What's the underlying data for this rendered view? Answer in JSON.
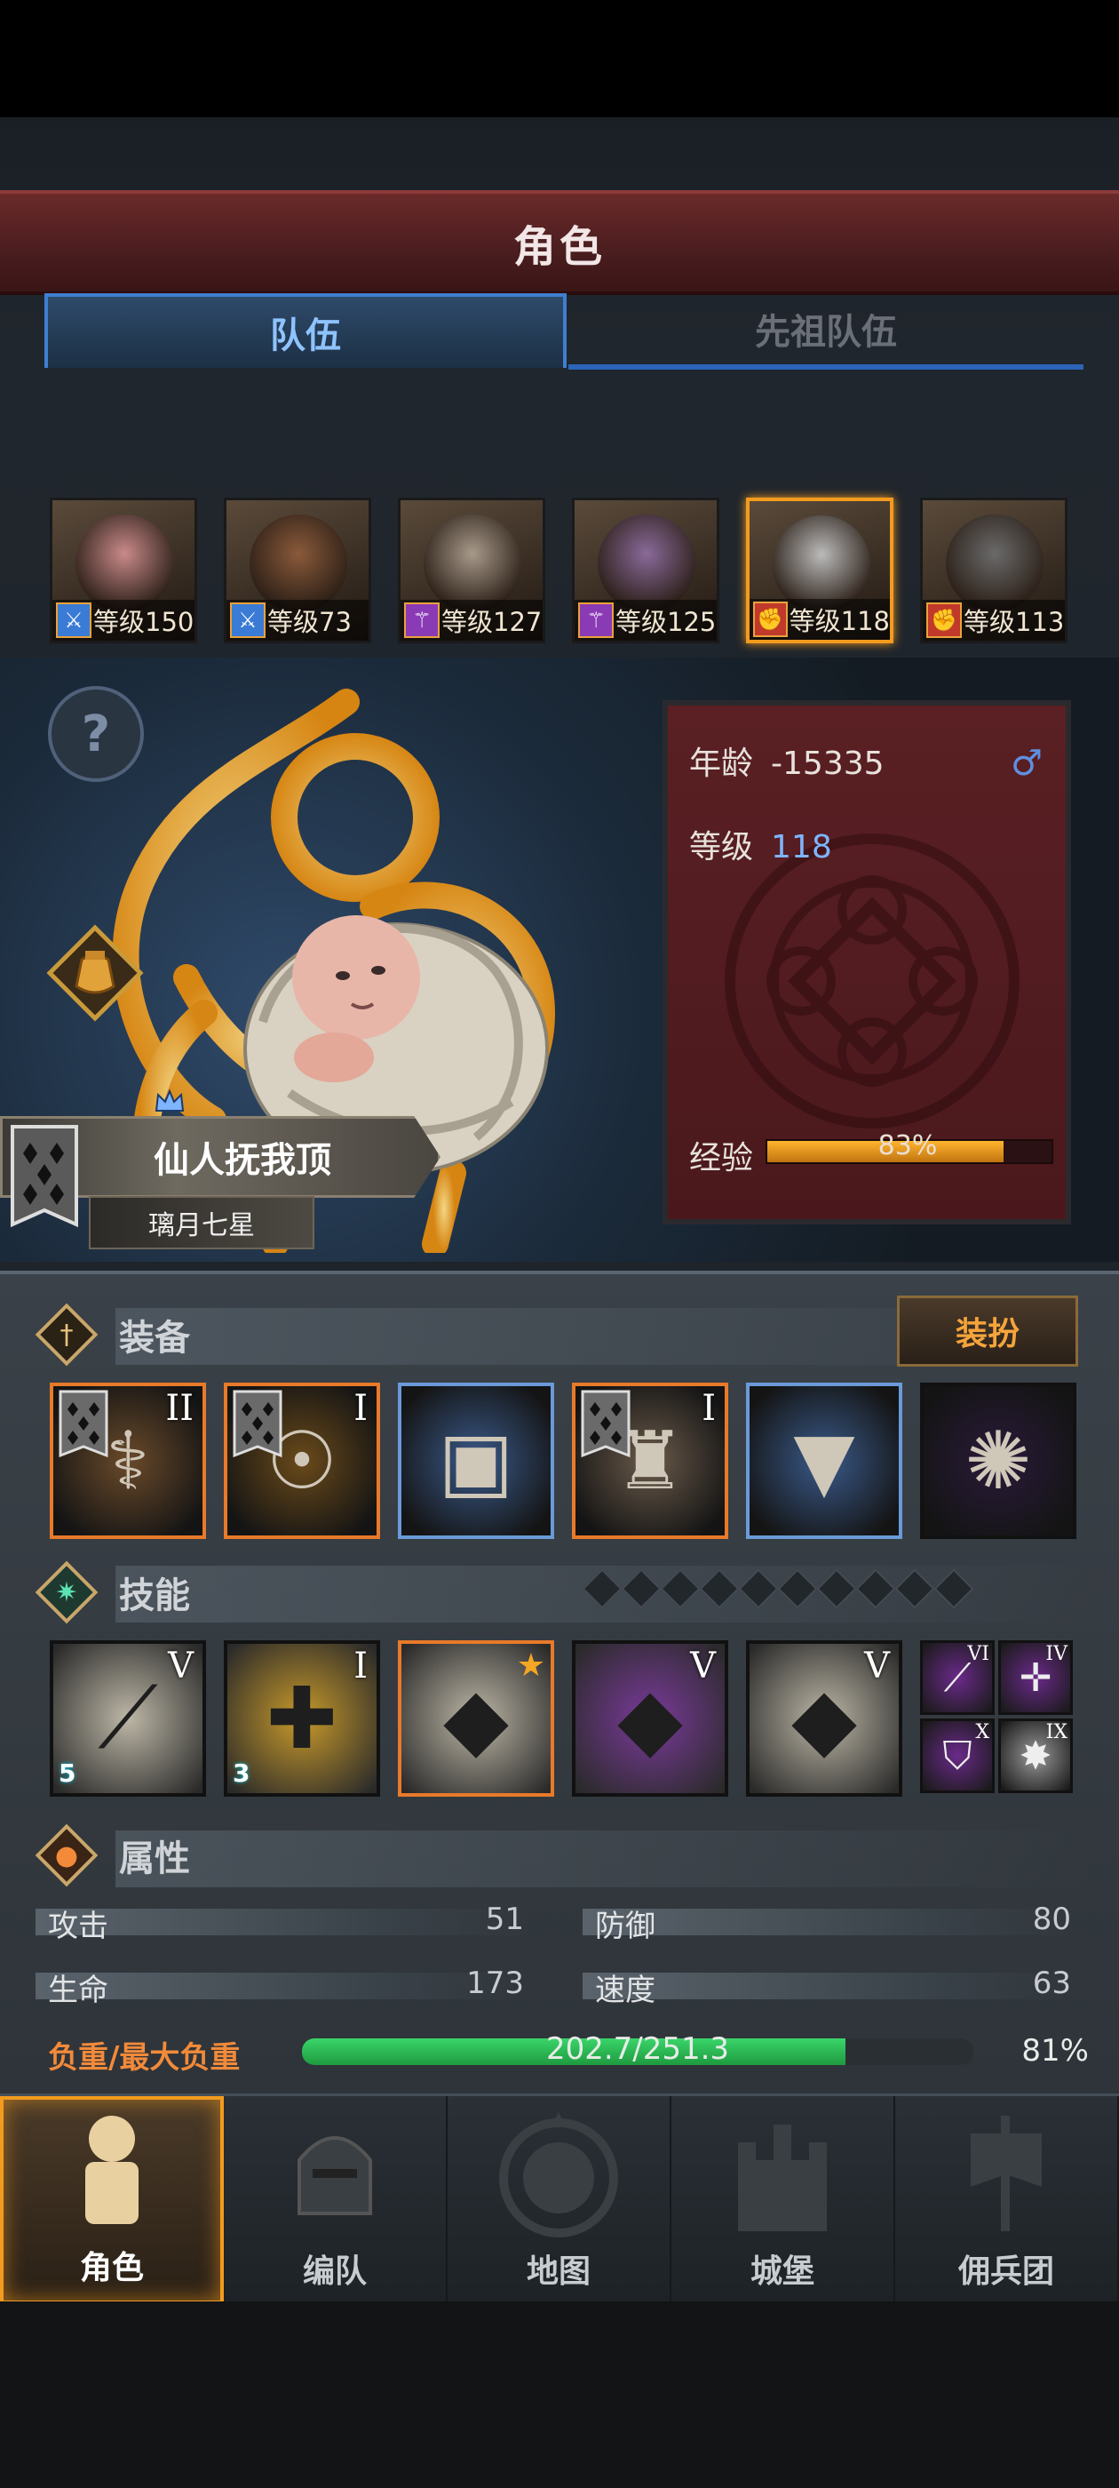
{
  "header": {
    "title": "角色"
  },
  "tabs": [
    {
      "label": "队伍",
      "active": true
    },
    {
      "label": "先祖队伍",
      "active": false
    }
  ],
  "party": [
    {
      "level_text": "等级150",
      "class_icon": "sword-icon",
      "badge_color": "#3a7bd5",
      "selected": false
    },
    {
      "level_text": "等级73",
      "class_icon": "sword-icon",
      "badge_color": "#3a7bd5",
      "selected": false
    },
    {
      "level_text": "等级127",
      "class_icon": "staff-icon",
      "badge_color": "#8b3ab5",
      "selected": false
    },
    {
      "level_text": "等级125",
      "class_icon": "staff-icon",
      "badge_color": "#8b3ab5",
      "selected": false
    },
    {
      "level_text": "等级118",
      "class_icon": "fist-icon",
      "badge_color": "#c0392b",
      "selected": true
    },
    {
      "level_text": "等级113",
      "class_icon": "fist-icon",
      "badge_color": "#c0392b",
      "selected": false
    }
  ],
  "character": {
    "name": "仙人抚我顶",
    "title": "璃月七星",
    "age_label": "年龄",
    "age_value": "-15335",
    "gender_icon": "male-icon",
    "level_label": "等级",
    "level_value": "118",
    "exp_label": "经验",
    "exp_text": "83%",
    "exp_fraction": 0.83
  },
  "equipment": {
    "title": "装备",
    "dress_label": "装扮",
    "slots": [
      {
        "name": "staff-item",
        "tier": "II",
        "border": "orange"
      },
      {
        "name": "tome-item",
        "tier": "I",
        "border": "orange"
      },
      {
        "name": "helmet-item",
        "tier": "",
        "border": "blue"
      },
      {
        "name": "armor-item",
        "tier": "I",
        "border": "orange"
      },
      {
        "name": "boots-item",
        "tier": "",
        "border": "blue"
      },
      {
        "name": "orb-item",
        "tier": "",
        "border": "black"
      }
    ]
  },
  "skills": {
    "title": "技能",
    "slots": [
      {
        "name": "spear-skill",
        "tier": "V",
        "count": "5",
        "border": "black"
      },
      {
        "name": "shield-heal-skill",
        "tier": "I",
        "count": "3",
        "border": "black"
      },
      {
        "name": "crystal-strike-skill",
        "tier": "",
        "count": "",
        "border": "orange"
      },
      {
        "name": "crystal-arm-skill",
        "tier": "V",
        "count": "",
        "border": "black"
      },
      {
        "name": "crystal-arm-skill-2",
        "tier": "V",
        "count": "",
        "border": "black"
      }
    ],
    "minis": [
      {
        "name": "dagger-mini-skill",
        "tier": "VI"
      },
      {
        "name": "target-mini-skill",
        "tier": "IV"
      },
      {
        "name": "shield-mini-skill",
        "tier": "X"
      },
      {
        "name": "burst-mini-skill",
        "tier": "IX"
      }
    ]
  },
  "attributes": {
    "title": "属性",
    "attack_label": "攻击",
    "attack": "51",
    "defense_label": "防御",
    "defense": "80",
    "hp_label": "生命",
    "hp": "173",
    "speed_label": "速度",
    "speed": "63",
    "load_label": "负重/最大负重",
    "load_text": "202.7/251.3",
    "load_pct": "81%",
    "load_fraction": 0.81
  },
  "nav": [
    {
      "label": "角色",
      "icon": "knight-icon",
      "active": true
    },
    {
      "label": "编队",
      "icon": "helmet-icon",
      "active": false
    },
    {
      "label": "地图",
      "icon": "compass-icon",
      "active": false
    },
    {
      "label": "城堡",
      "icon": "castle-icon",
      "active": false
    },
    {
      "label": "佣兵团",
      "icon": "banner-icon",
      "active": false
    }
  ],
  "colors": {
    "accent_orange": "#f39b1e",
    "tab_blue": "#3f7fcf",
    "title_red": "#5a2024",
    "load_green": "#2ec05a"
  }
}
